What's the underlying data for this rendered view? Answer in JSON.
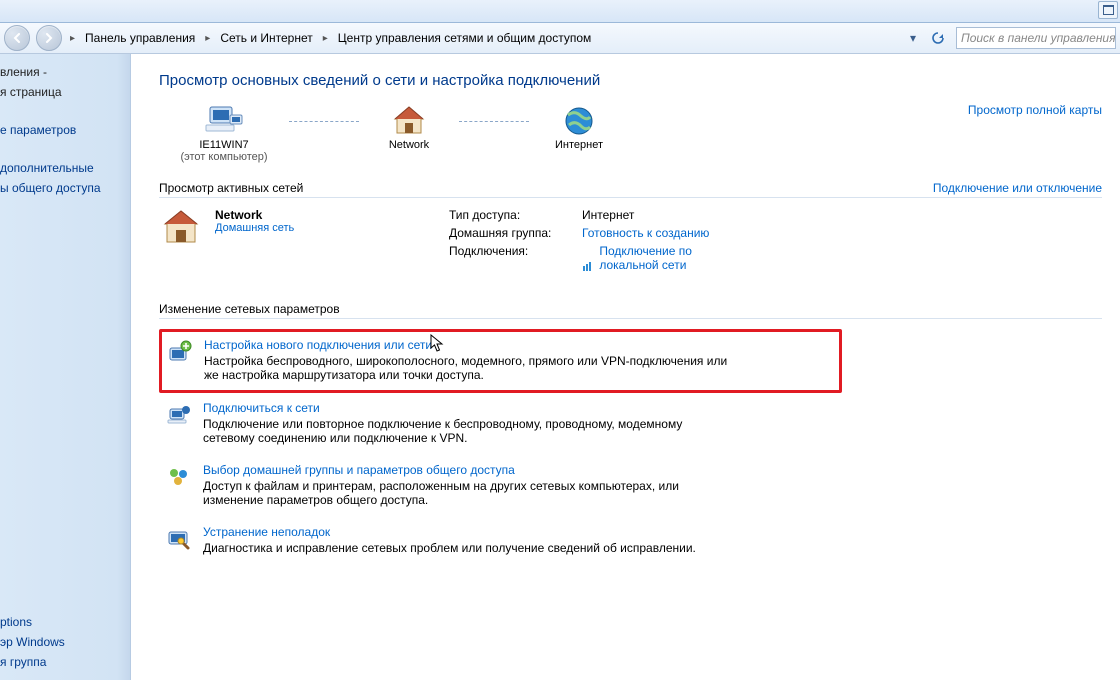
{
  "search": {
    "placeholder": "Поиск в панели управления"
  },
  "breadcrumbs": {
    "items": [
      "Панель управления",
      "Сеть и Интернет",
      "Центр управления сетями и общим доступом"
    ]
  },
  "sidebar": {
    "items": [
      "вления -",
      "я страница",
      "е параметров",
      "дополнительные",
      "ы общего доступа"
    ],
    "bottom": [
      "ptions",
      "эр Windows",
      "я группа"
    ]
  },
  "main": {
    "title": "Просмотр основных сведений о сети и настройка подключений",
    "map": {
      "node1_name": "IE11WIN7",
      "node1_sub": "(этот компьютер)",
      "node2_name": "Network",
      "node3_name": "Интернет",
      "view_map": "Просмотр полной карты"
    },
    "active_section": {
      "label": "Просмотр активных сетей",
      "link": "Подключение или отключение",
      "net_name": "Network",
      "net_type": "Домашняя сеть",
      "rows": {
        "access_label": "Тип доступа:",
        "access_value": "Интернет",
        "homegroup_label": "Домашняя группа:",
        "homegroup_value": "Готовность к созданию",
        "connections_label": "Подключения:",
        "connections_value": "Подключение по локальной сети"
      }
    },
    "change_section": {
      "label": "Изменение сетевых параметров"
    },
    "tasks": [
      {
        "title": "Настройка нового подключения или сети",
        "desc": "Настройка беспроводного, широкополосного, модемного, прямого или VPN-подключения или же настройка маршрутизатора или точки доступа."
      },
      {
        "title": "Подключиться к сети",
        "desc": "Подключение или повторное подключение к беспроводному, проводному, модемному сетевому соединению или подключение к VPN."
      },
      {
        "title": "Выбор домашней группы и параметров общего доступа",
        "desc": "Доступ к файлам и принтерам, расположенным на других сетевых компьютерах, или изменение параметров общего доступа."
      },
      {
        "title": "Устранение неполадок",
        "desc": "Диагностика и исправление сетевых проблем или получение сведений об исправлении."
      }
    ]
  }
}
